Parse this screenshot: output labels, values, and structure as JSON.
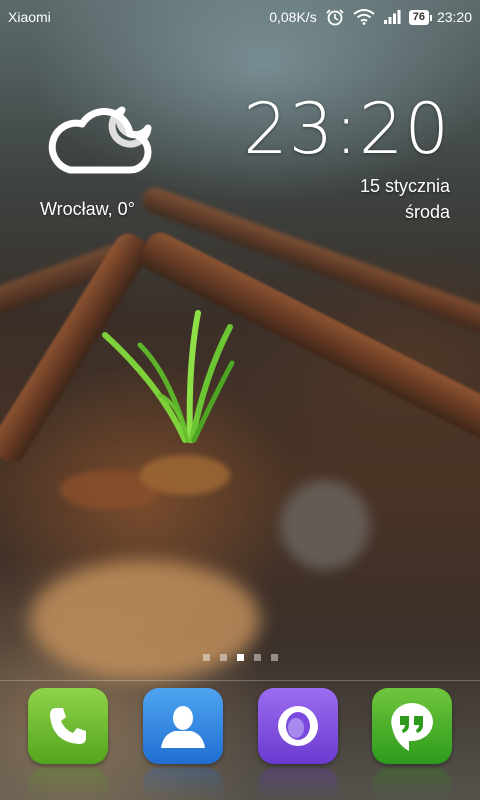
{
  "status_bar": {
    "carrier": "Xiaomi",
    "network_speed": "0,08K/s",
    "alarm_icon": "alarm-clock-icon",
    "wifi_icon": "wifi-icon",
    "signal_icon": "signal-bars-icon",
    "battery_level": "76",
    "time": "23:20"
  },
  "weather_widget": {
    "icon": "cloud-moon-icon",
    "location_temp": "Wrocław, 0°"
  },
  "clock_widget": {
    "time": "23:20",
    "date": "15 stycznia",
    "weekday": "środa"
  },
  "page_indicator": {
    "total_pages": 5,
    "active_page": 3
  },
  "dock": {
    "apps": [
      {
        "name": "phone",
        "icon": "phone-handset-icon",
        "color": "#5fb12a"
      },
      {
        "name": "contacts",
        "icon": "person-silhouette-icon",
        "color": "#2f86e0"
      },
      {
        "name": "browser",
        "icon": "browser-ring-icon",
        "color": "#7a4ae0"
      },
      {
        "name": "hangouts",
        "icon": "speech-bubble-quotes-icon",
        "color": "#3aa524"
      }
    ]
  }
}
